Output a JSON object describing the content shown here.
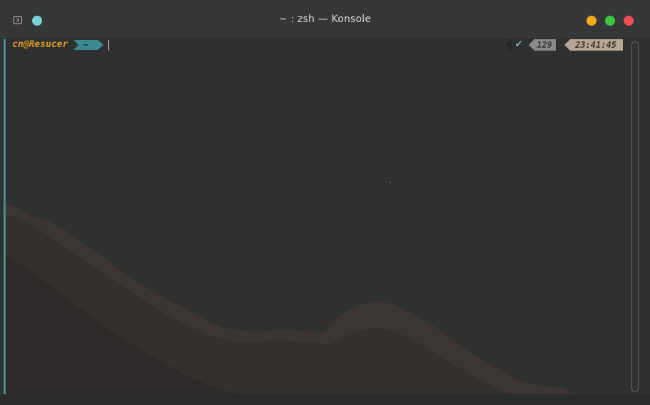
{
  "window": {
    "title": "~ : zsh — Konsole",
    "controls": {
      "minimize_color": "#f2ab1d",
      "maximize_color": "#3fc845",
      "close_color": "#ef4f52",
      "pin_color": "#79d3d2"
    },
    "icons": [
      "terminal-icon",
      "pin-icon"
    ]
  },
  "prompt": {
    "user_host": "cn@Resucer",
    "directory": "~",
    "user_color": "#d99a23",
    "dir_segment_color": "#3b8b91"
  },
  "right_prompt": {
    "status_icon": "✔",
    "history_number": "129",
    "time": "23:41:45",
    "number_segment_color": "#8a8a8a",
    "time_segment_color": "#b6a694"
  },
  "colors": {
    "terminal_accent": "#4d8a8e",
    "background": "#2f3030"
  }
}
